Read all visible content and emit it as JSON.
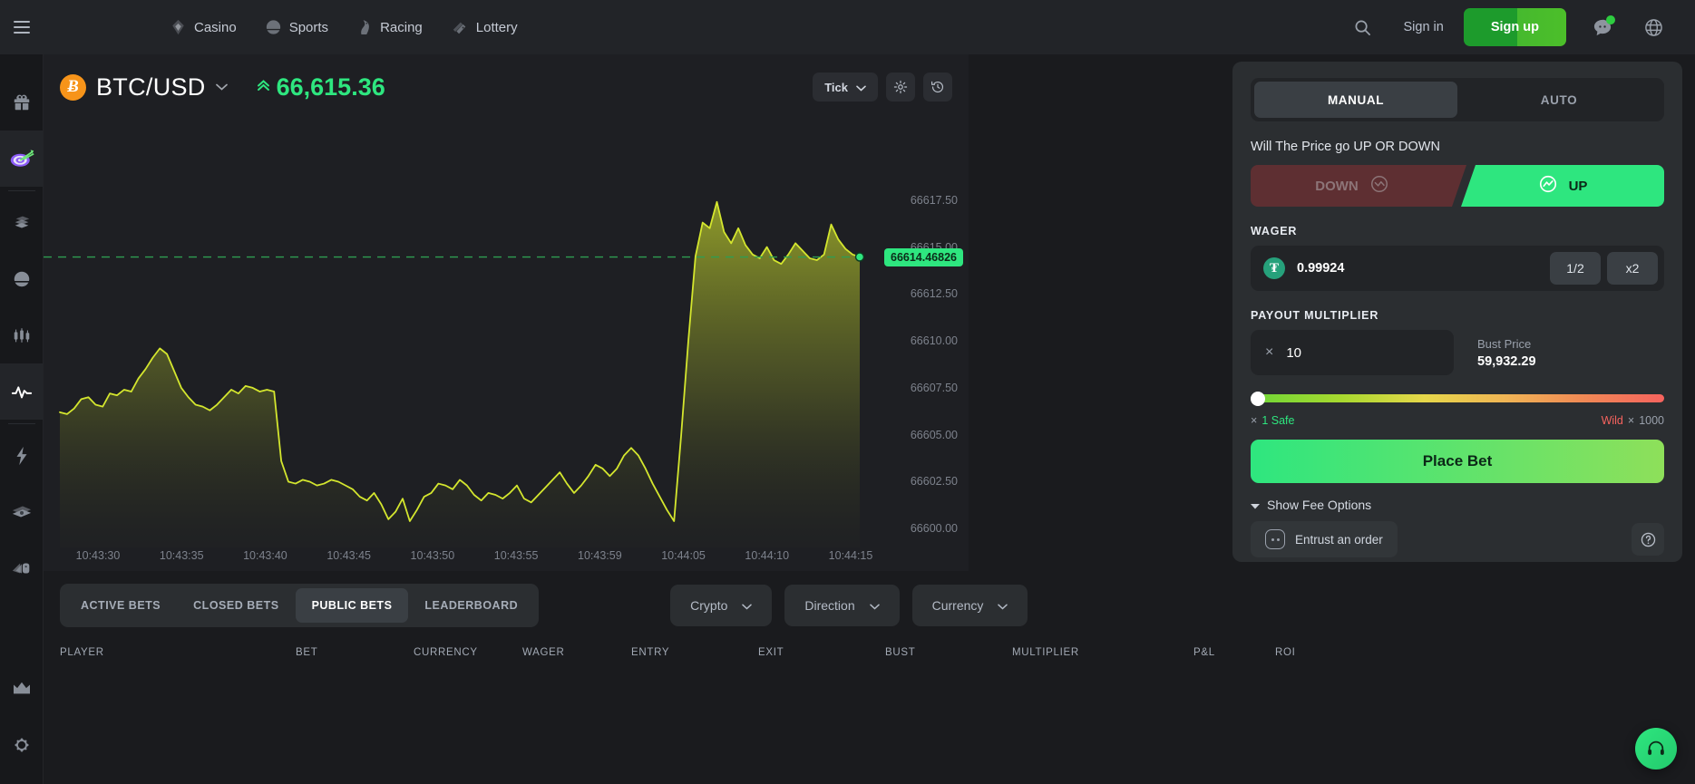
{
  "header": {
    "menu_icon": "hamburger-icon",
    "nav": [
      {
        "label": "Casino",
        "icon": "diamond-icon"
      },
      {
        "label": "Sports",
        "icon": "sports-ball-icon"
      },
      {
        "label": "Racing",
        "icon": "horse-icon"
      },
      {
        "label": "Lottery",
        "icon": "ticket-icon"
      }
    ],
    "search_icon": "search-icon",
    "sign_in": "Sign in",
    "sign_up": "Sign up",
    "chat_icon": "chat-icon",
    "globe_icon": "globe-icon",
    "chat_status_color": "#2ecc40"
  },
  "sidebar": {
    "items": [
      {
        "name": "gift-icon",
        "label": "Promotions"
      },
      {
        "name": "target-icon",
        "label": "Prediction",
        "active": true
      },
      {
        "name": "cards-icon",
        "label": "Casino"
      },
      {
        "name": "sports-icon",
        "label": "Sports"
      },
      {
        "name": "candlestick-icon",
        "label": "Markets"
      },
      {
        "name": "pulse-icon",
        "label": "Trading",
        "active": true
      },
      {
        "name": "lightning-icon",
        "label": "Fast Games"
      },
      {
        "name": "money-icon",
        "label": "Cash"
      },
      {
        "name": "tickets-icon",
        "label": "Tickets"
      },
      {
        "name": "crown-icon",
        "label": "VIP"
      },
      {
        "name": "settings-icon",
        "label": "Settings"
      }
    ]
  },
  "chart": {
    "pair": "BTC/USD",
    "coin_symbol": "Ƀ",
    "price": "66,615.36",
    "price_direction_icon": "double-chevron-up-icon",
    "price_color": "#2ee67f",
    "interval_label": "Tick",
    "settings_icon": "gear-icon",
    "history_icon": "history-icon",
    "current_price_tag": "66614.46826",
    "line_color": "#d4e62e"
  },
  "chart_data": {
    "type": "area",
    "title": "BTC/USD tick chart",
    "xlabel": "",
    "ylabel": "",
    "grid": false,
    "legend": "none",
    "ylim": [
      66599.0,
      66618.5
    ],
    "y_ticks": [
      "66617.50",
      "66615.00",
      "66612.50",
      "66610.00",
      "66607.50",
      "66605.00",
      "66602.50",
      "66600.00"
    ],
    "y_tick_values": [
      66617.5,
      66615.0,
      66612.5,
      66610.0,
      66607.5,
      66605.0,
      66602.5,
      66600.0
    ],
    "x_ticks": [
      "10:43:30",
      "10:43:35",
      "10:43:40",
      "10:43:45",
      "10:43:50",
      "10:43:55",
      "10:43:59",
      "10:44:05",
      "10:44:10",
      "10:44:15"
    ],
    "reference_line": 66614.46826,
    "reference_line_label": "66614.46826",
    "series": [
      {
        "name": "BTC/USD",
        "color": "#d4e62e",
        "values": [
          66606.2,
          66606.1,
          66606.4,
          66606.9,
          66607.0,
          66606.6,
          66606.5,
          66607.2,
          66607.1,
          66607.4,
          66607.3,
          66608.0,
          66608.5,
          66609.1,
          66609.6,
          66609.3,
          66608.4,
          66607.5,
          66607.0,
          66606.6,
          66606.5,
          66606.3,
          66606.6,
          66607.0,
          66607.4,
          66607.2,
          66607.6,
          66607.5,
          66607.3,
          66607.4,
          66607.3,
          66603.6,
          66602.5,
          66602.4,
          66602.6,
          66602.5,
          66602.3,
          66602.4,
          66602.6,
          66602.5,
          66602.3,
          66602.1,
          66601.7,
          66601.5,
          66601.9,
          66601.3,
          66600.5,
          66600.9,
          66601.6,
          66600.4,
          66601.0,
          66601.7,
          66601.9,
          66602.4,
          66602.3,
          66602.1,
          66602.6,
          66602.3,
          66601.8,
          66601.5,
          66601.9,
          66601.8,
          66601.6,
          66601.9,
          66602.3,
          66601.6,
          66601.4,
          66601.8,
          66602.2,
          66602.6,
          66603.0,
          66602.4,
          66601.9,
          66602.3,
          66602.8,
          66603.4,
          66603.2,
          66602.8,
          66603.2,
          66603.9,
          66604.3,
          66603.9,
          66603.2,
          66602.4,
          66601.7,
          66601.0,
          66600.4,
          66605.0,
          66610.0,
          66614.5,
          66616.3,
          66616.0,
          66617.4,
          66615.8,
          66615.2,
          66616.0,
          66615.1,
          66614.6,
          66614.4,
          66615.0,
          66614.3,
          66614.1,
          66614.6,
          66615.2,
          66614.8,
          66614.4,
          66614.3,
          66614.6,
          66616.2,
          66615.4,
          66614.9,
          66614.6,
          66614.47
        ]
      }
    ]
  },
  "bet_panel": {
    "modes": [
      {
        "label": "MANUAL",
        "active": true
      },
      {
        "label": "AUTO",
        "active": false
      }
    ],
    "question": "Will The Price go UP OR DOWN",
    "direction_down": "DOWN",
    "direction_up": "UP",
    "wager_label": "WAGER",
    "wager_value": "0.99924",
    "wager_currency_icon": "usdt-icon",
    "wager_currency_symbol": "₮",
    "half_button": "1/2",
    "double_button": "x2",
    "payout_label": "PAYOUT MULTIPLIER",
    "multiplier_prefix": "×",
    "multiplier_value": "10",
    "bust_price_label": "Bust Price",
    "bust_price_value": "59,932.29",
    "slider_min_label": "1 Safe",
    "slider_min_prefix": "×",
    "slider_max_label": "Wild",
    "slider_max_value": "1000",
    "slider_max_prefix": "×",
    "slider_position_pct": 0,
    "place_bet": "Place Bet",
    "fee_options": "Show Fee Options",
    "entrust_order": "Entrust an order",
    "help_icon": "question-mark-icon"
  },
  "bottom": {
    "tabs": [
      {
        "label": "ACTIVE BETS",
        "active": false
      },
      {
        "label": "CLOSED BETS",
        "active": false
      },
      {
        "label": "PUBLIC BETS",
        "active": true
      },
      {
        "label": "LEADERBOARD",
        "active": false
      }
    ],
    "filters": [
      {
        "label": "Crypto"
      },
      {
        "label": "Direction"
      },
      {
        "label": "Currency"
      }
    ],
    "columns": [
      "PLAYER",
      "BET",
      "CURRENCY",
      "WAGER",
      "ENTRY",
      "EXIT",
      "BUST",
      "MULTIPLIER",
      "P&L",
      "ROI"
    ],
    "support_icon": "headset-icon"
  }
}
